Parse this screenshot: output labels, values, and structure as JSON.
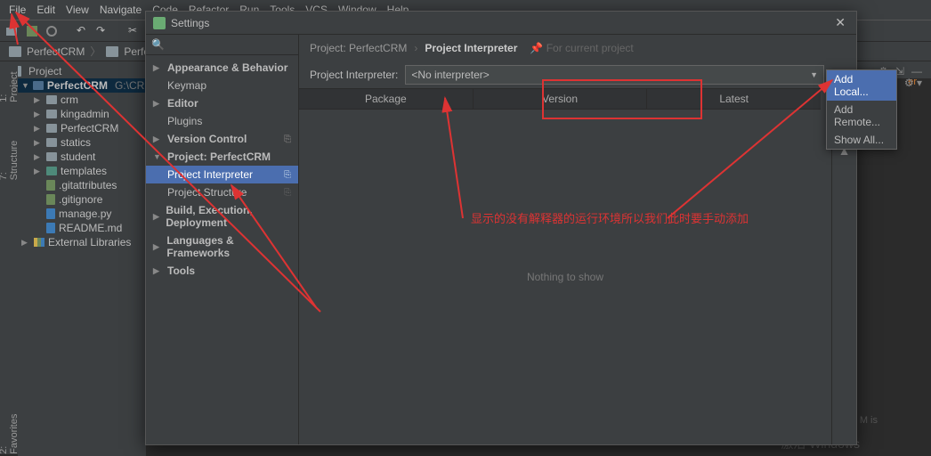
{
  "menubar": [
    "File",
    "Edit",
    "View",
    "Navigate",
    "Code",
    "Refactor",
    "Run",
    "Tools",
    "VCS",
    "Window",
    "Help"
  ],
  "breadcrumb": {
    "project": "PerfectCRM",
    "item2": "PerfectCRM"
  },
  "proj_header": {
    "label": "Project"
  },
  "path_row": {
    "name": "PerfectCRM",
    "path": "G:\\CRM\\Pe"
  },
  "tree": {
    "crm": "crm",
    "kingadmin": "kingadmin",
    "perfectcrm": "PerfectCRM",
    "statics": "statics",
    "student": "student",
    "templates": "templates",
    "gitattributes": ".gitattributes",
    "gitignore": ".gitignore",
    "manage": "manage.py",
    "readme": "README.md",
    "extlib": "External Libraries"
  },
  "left_tabs": {
    "project": "1: Project",
    "structure": "7: Structure",
    "favorites": "2: Favorites"
  },
  "dialog": {
    "title": "Settings",
    "search_placeholder": "",
    "sidebar": {
      "appearance": "Appearance & Behavior",
      "keymap": "Keymap",
      "editor": "Editor",
      "plugins": "Plugins",
      "vcs": "Version Control",
      "project": "Project: PerfectCRM",
      "interpreter": "Project Interpreter",
      "structure": "Project Structure",
      "build": "Build, Execution, Deployment",
      "languages": "Languages & Frameworks",
      "tools": "Tools"
    },
    "crumb": {
      "project": "Project: PerfectCRM",
      "interp": "Project Interpreter",
      "hint": "For current project"
    },
    "interp_label": "Project Interpreter:",
    "interp_value": "<No interpreter>",
    "cols": {
      "package": "Package",
      "version": "Version",
      "latest": "Latest"
    },
    "empty": "Nothing to show",
    "annotation": "显示的没有解释器的运行环境所以我们此时要手动添加",
    "menu": {
      "add_local": "Add Local...",
      "add_remote": "Add Remote...",
      "show_all": "Show All..."
    }
  },
  "right": {
    "text": "er"
  },
  "watermark": "激活 Windows",
  "watermark2": "M is"
}
